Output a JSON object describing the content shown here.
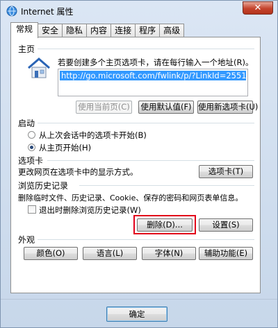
{
  "window": {
    "title": "Internet 属性",
    "close_label": "✕"
  },
  "tabs": [
    {
      "label": "常规",
      "active": true
    },
    {
      "label": "安全"
    },
    {
      "label": "隐私"
    },
    {
      "label": "内容"
    },
    {
      "label": "连接"
    },
    {
      "label": "程序"
    },
    {
      "label": "高级"
    }
  ],
  "home": {
    "group_label": "主页",
    "instruction": "若要创建多个主页选项卡，请在每行输入一个地址(R)。",
    "url_value": "http://go.microsoft.com/fwlink/p/?LinkId=2551",
    "btn_use_current": "使用当前页(C)",
    "btn_use_default": "使用默认值(F)",
    "btn_use_new_tab": "使用新选项卡(U)"
  },
  "startup": {
    "group_label": "启动",
    "option_last_session": "从上次会话中的选项卡开始(B)",
    "option_home": "从主页开始(H)"
  },
  "tabs_section": {
    "group_label": "选项卡",
    "description": "更改网页在选项卡中的显示方式。",
    "button": "选项卡(T)"
  },
  "history": {
    "group_label": "浏览历史记录",
    "description": "删除临时文件、历史记录、Cookie、保存的密码和网页表单信息。",
    "checkbox_label": "退出时删除浏览历史记录(W)",
    "btn_delete": "删除(D)...",
    "btn_settings": "设置(S)"
  },
  "appearance": {
    "group_label": "外观",
    "btn_colors": "颜色(O)",
    "btn_languages": "语言(L)",
    "btn_fonts": "字体(N)",
    "btn_accessibility": "辅助功能(E)"
  },
  "footer": {
    "ok": "确定"
  },
  "colors": {
    "highlight": "#e2001a",
    "selection": "#3399ff"
  }
}
